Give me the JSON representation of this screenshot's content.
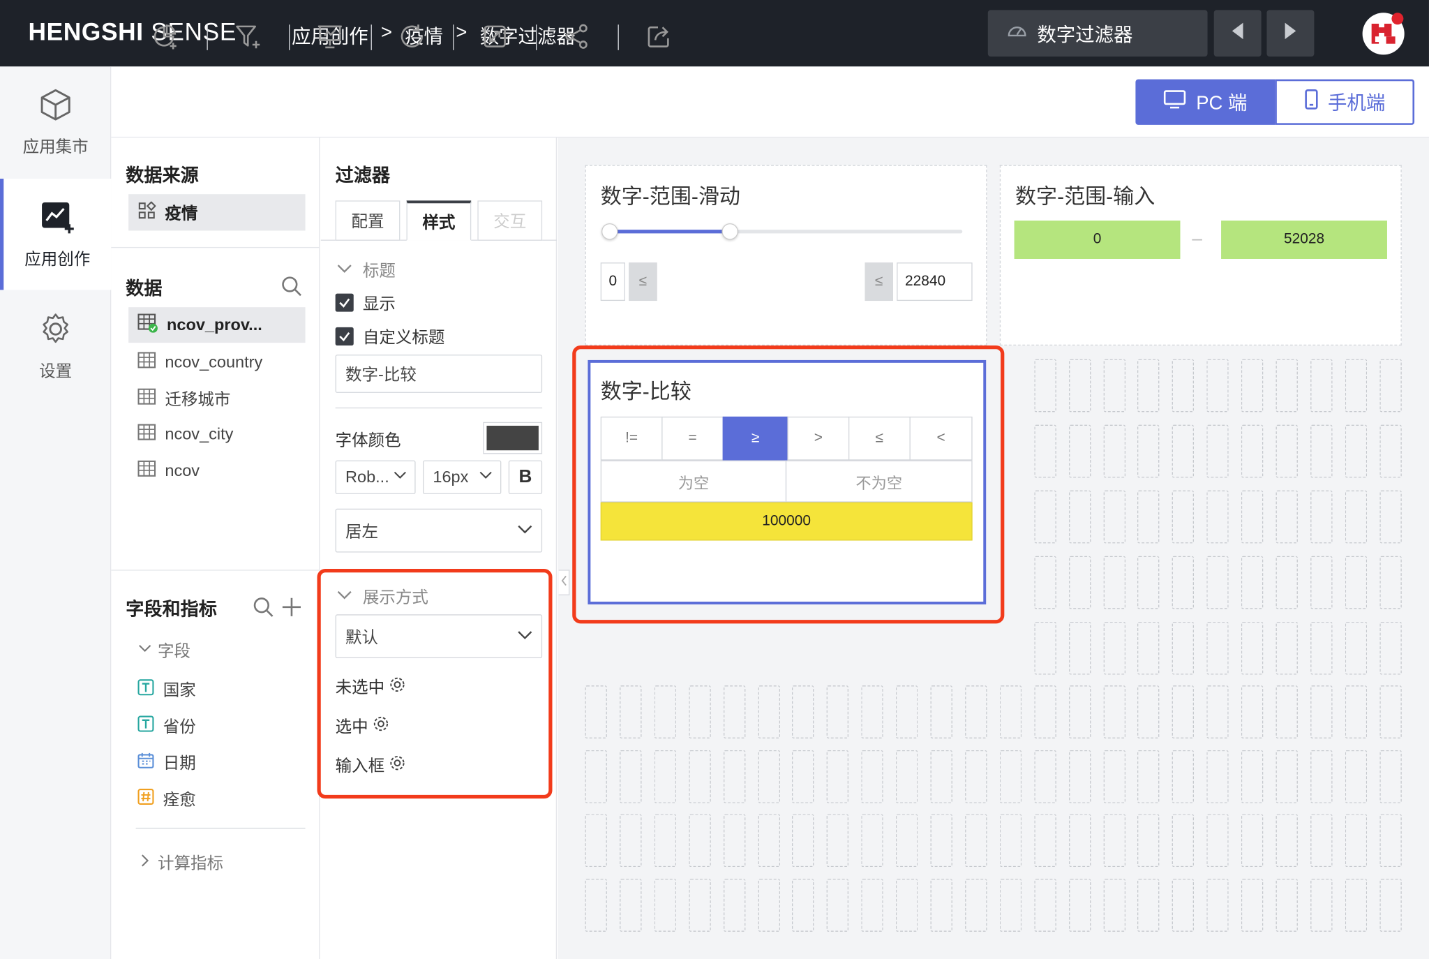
{
  "app": {
    "logo_bold": "HENGSHI",
    "logo_light": " SENSE"
  },
  "breadcrumb": [
    "应用创作",
    ">",
    "疫情",
    ">",
    "数字过滤器"
  ],
  "current_dashboard": "数字过滤器",
  "left_nav": [
    {
      "label": "应用集市",
      "icon": "cube-icon"
    },
    {
      "label": "应用创作",
      "icon": "chart-add-icon",
      "active": true
    },
    {
      "label": "设置",
      "icon": "gear-icon"
    }
  ],
  "device_toggle": {
    "pc": "PC 端",
    "mobile": "手机端",
    "active": "pc"
  },
  "data_panel": {
    "source_title": "数据来源",
    "source_item": "疫情",
    "data_title": "数据",
    "datasets": [
      "ncov_prov...",
      "ncov_country",
      "迁移城市",
      "ncov_city",
      "ncov"
    ],
    "fields_title": "字段和指标",
    "fields_group": "字段",
    "fields": [
      {
        "name": "国家",
        "type": "T"
      },
      {
        "name": "省份",
        "type": "T"
      },
      {
        "name": "日期",
        "type": "date"
      },
      {
        "name": "痊愈",
        "type": "#"
      }
    ],
    "calc_group": "计算指标"
  },
  "filter_panel": {
    "title": "过滤器",
    "tabs": [
      "配置",
      "样式",
      "交互"
    ],
    "active_tab": "样式",
    "section_title": "标题",
    "show_label": "显示",
    "custom_title_label": "自定义标题",
    "custom_title_value": "数字-比较",
    "font_color_label": "字体颜色",
    "font_color": "#444444",
    "font_family": "Rob...",
    "font_size": "16px",
    "bold_label": "B",
    "align": "居左",
    "display_section": "展示方式",
    "display_mode": "默认",
    "unselected": "未选中",
    "selected": "选中",
    "input_box": "输入框"
  },
  "canvas": {
    "slider_card": {
      "title": "数字-范围-滑动",
      "min": "0",
      "max": "22840",
      "op_left": "≤",
      "op_right": "≤",
      "fill_fraction": 0.34
    },
    "range_input_card": {
      "title": "数字-范围-输入",
      "from": "0",
      "to": "52028",
      "dash": "–"
    },
    "compare_card": {
      "title": "数字-比较",
      "ops": [
        "!=",
        "=",
        "≥",
        ">",
        "≤",
        "<"
      ],
      "selected_op": "≥",
      "empty_ops": [
        "为空",
        "不为空"
      ],
      "value": "100000"
    }
  },
  "colors": {
    "accent": "#5b6dd8",
    "highlight_red": "#f23b1b",
    "green_input": "#b5e57e",
    "yellow_input": "#f5e43a",
    "topbar": "#1e2229"
  }
}
